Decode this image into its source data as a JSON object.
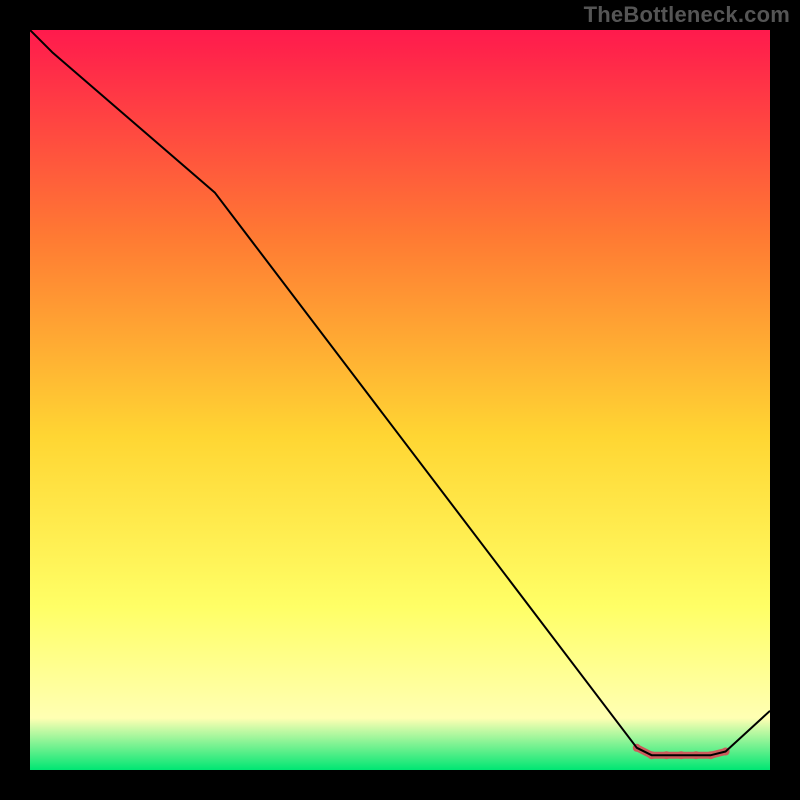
{
  "watermark": "TheBottleneck.com",
  "chart_data": {
    "type": "line",
    "title": "",
    "xlabel": "",
    "ylabel": "",
    "xlim": [
      0,
      100
    ],
    "ylim": [
      0,
      100
    ],
    "grid": false,
    "legend": false,
    "background_gradient": {
      "top": "#ff1a4d",
      "mid_upper": "#ff7a33",
      "mid": "#ffd633",
      "mid_lower": "#ffff66",
      "lower": "#ffffb3",
      "bottom": "#00e673"
    },
    "series": [
      {
        "name": "bottleneck-curve",
        "stroke": "#000000",
        "x": [
          0,
          3,
          25,
          82,
          84,
          92,
          94,
          100
        ],
        "y": [
          100,
          97,
          78,
          3,
          2,
          2,
          2.5,
          8
        ]
      }
    ],
    "highlight": {
      "name": "highlight-flat-zone",
      "color": "#cc5c5c",
      "radius_px": 4,
      "stroke_width_px": 7,
      "x": [
        82,
        84,
        86,
        88,
        90,
        92,
        94
      ],
      "y": [
        3,
        2,
        2,
        2,
        2,
        2,
        2.5
      ]
    }
  }
}
